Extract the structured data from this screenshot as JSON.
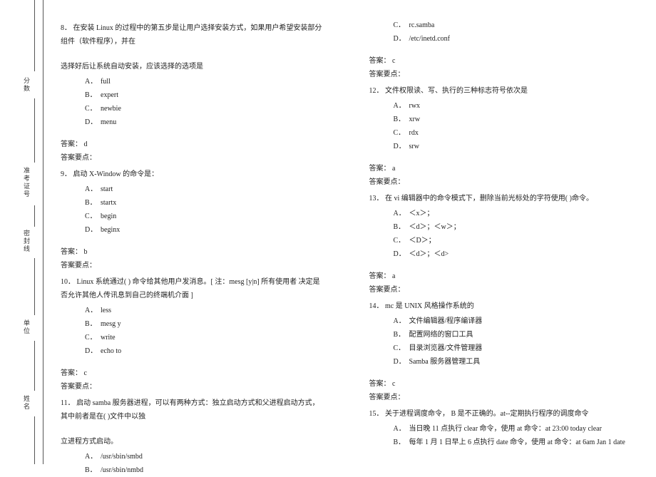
{
  "margin": {
    "label_fenshu": "分数",
    "label_zkz": "准考证号",
    "label_mfx": "密封线",
    "label_danwei": "单位",
    "label_xingming": "姓名"
  },
  "left": {
    "q8": {
      "text": "8．  在安装 Linux 的过程中的第五步是让用户选择安装方式，如果用户希望安装部分组件（软件程序），并在",
      "text2": "选择好后让系统自动安装，应该选择的选项是",
      "A": "full",
      "B": "expert",
      "C": "newbie",
      "D": "menu",
      "answer": "答案： d",
      "points": "答案要点："
    },
    "q9": {
      "text": "9．  启动 X-Window 的命令是：",
      "A": "start",
      "B": "startx",
      "C": "begin",
      "D": "beginx",
      "answer": "答案： b",
      "points": "答案要点："
    },
    "q10": {
      "text": "10．  Linux 系统通过(    ) 命令给其他用户发消息。[ 注：mesg [y|n]  所有使用者  决定是否允许其他人传讯息到自己的终端机介面 ]",
      "A": "less",
      "B": "mesg y",
      "C": "write",
      "D": "echo to",
      "answer": "答案： c",
      "points": "答案要点："
    },
    "q11": {
      "text": "11．  启动 samba 服务器进程，可以有两种方式：独立启动方式和父进程启动方式，其中前者是在( )文件中以独",
      "text2": "立进程方式启动。",
      "A": "/usr/sbin/smbd",
      "B": "/usr/sbin/nmbd"
    }
  },
  "right": {
    "q11c": {
      "C": "rc.samba",
      "D": "/etc/inetd.conf",
      "answer": "答案： c",
      "points": "答案要点："
    },
    "q12": {
      "text": "12．  文件权限读、写、执行的三种标志符号依次是",
      "A": "rwx",
      "B": "xrw",
      "C": "rdx",
      "D": "srw",
      "answer": "答案： a",
      "points": "答案要点："
    },
    "q13": {
      "text": "13．  在 vi 编辑器中的命令模式下，删除当前光标处的字符使用(    )命令。",
      "A": "＜x＞；",
      "B": "＜d＞；＜w＞；",
      "C": "＜D＞；",
      "D": "＜d＞；＜d>",
      "answer": "答案： a",
      "points": "答案要点："
    },
    "q14": {
      "text": "14．  mc 是 UNIX 风格操作系统的",
      "A": "文件编辑器/程序编译器",
      "B": "配置网络的窗口工具",
      "C": "目录浏览器/文件管理器",
      "D": "Samba 服务器管理工具",
      "answer": "答案： c",
      "points": "答案要点："
    },
    "q15": {
      "text": "15．  关于进程调度命令，  B  是不正确的。at--定期执行程序的调度命令",
      "A": "当日晚 11 点执行 clear 命令，使用 at 命令：at 23:00 today clear",
      "B": "每年 1 月 1 日早上 6 点执行 date 命令，使用 at 命令：at 6am Jan 1 date"
    }
  }
}
